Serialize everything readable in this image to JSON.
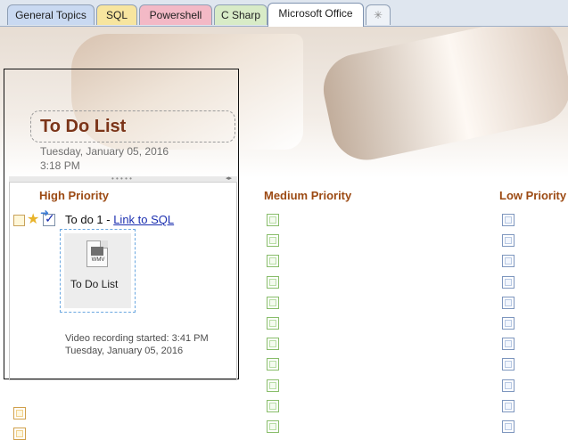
{
  "tabs": [
    {
      "label": "General Topics",
      "color": "#c9d9f1"
    },
    {
      "label": "SQL",
      "color": "#f7e59f"
    },
    {
      "label": "Powershell",
      "color": "#f3b9c6"
    },
    {
      "label": "C Sharp",
      "color": "#d8ebc7"
    },
    {
      "label": "Microsoft Office",
      "color": "#ffffff"
    },
    {
      "label": "✳",
      "color": "#eef2f7"
    }
  ],
  "page": {
    "title": "To Do List",
    "date": "Tuesday, January 05, 2016",
    "time": "3:18 PM"
  },
  "columns": {
    "high": "High Priority",
    "medium": "Medium Priority",
    "low": "Low Priority"
  },
  "todo": {
    "prefix": "To do 1 - ",
    "link": "Link to SQL"
  },
  "attachment": {
    "label": "To Do List",
    "icon_text": "WMV"
  },
  "recording": {
    "line1": "Video recording started: 3:41 PM",
    "line2": "Tuesday, January 05, 2016"
  },
  "colors": {
    "title": "#7b3418",
    "column_heading": "#9c4a13",
    "link": "#1b2fb0"
  }
}
